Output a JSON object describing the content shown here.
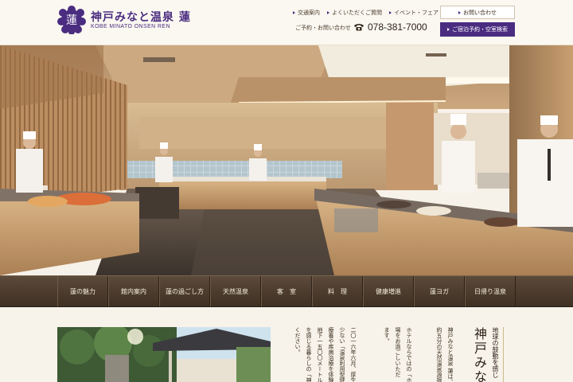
{
  "brand": {
    "mark_char": "蓮",
    "name_jp": "神戸みなと温泉 蓮",
    "name_en": "KOBE MINATO ONSEN REN",
    "color": "#4a2d80"
  },
  "util_nav": [
    {
      "label": "交通案内"
    },
    {
      "label": "よくいただくご質問"
    },
    {
      "label": "イベント・フェア"
    }
  ],
  "contact_button": "お問い合わせ",
  "phone": {
    "label": "ご予約・お問い合わせ",
    "icon": "phone-icon",
    "number": "078-381-7000"
  },
  "reserve_button": "ご宿泊予約・空室検索",
  "global_nav": [
    {
      "label": "蓮の魅力"
    },
    {
      "label": "館内案内"
    },
    {
      "label": "蓮の過ごし方"
    },
    {
      "label": "天然温泉"
    },
    {
      "label": "客　室"
    },
    {
      "label": "料　理"
    },
    {
      "label": "健康増進"
    },
    {
      "label": "蓮ヨガ"
    },
    {
      "label": "日帰り温泉"
    }
  ],
  "intro": {
    "title": "神戸みな",
    "catch": "地球の鼓動を感じ",
    "col1": "神戸みなと温泉 蓮は、",
    "col2": "約五分の天然温泉源掘",
    "col3": "ホテルならではの「ホ",
    "col4": "場をお過ごしいただ",
    "col5": "ます。",
    "col6": "二〇一六年六月、厚生",
    "col7": "少ない「温泉利用型健",
    "col8": "療養や疾病治療を体験",
    "col9": "地下一五〇〇メートル",
    "col10": "を感じる暮らしの「神戸",
    "col11": "ください。"
  }
}
